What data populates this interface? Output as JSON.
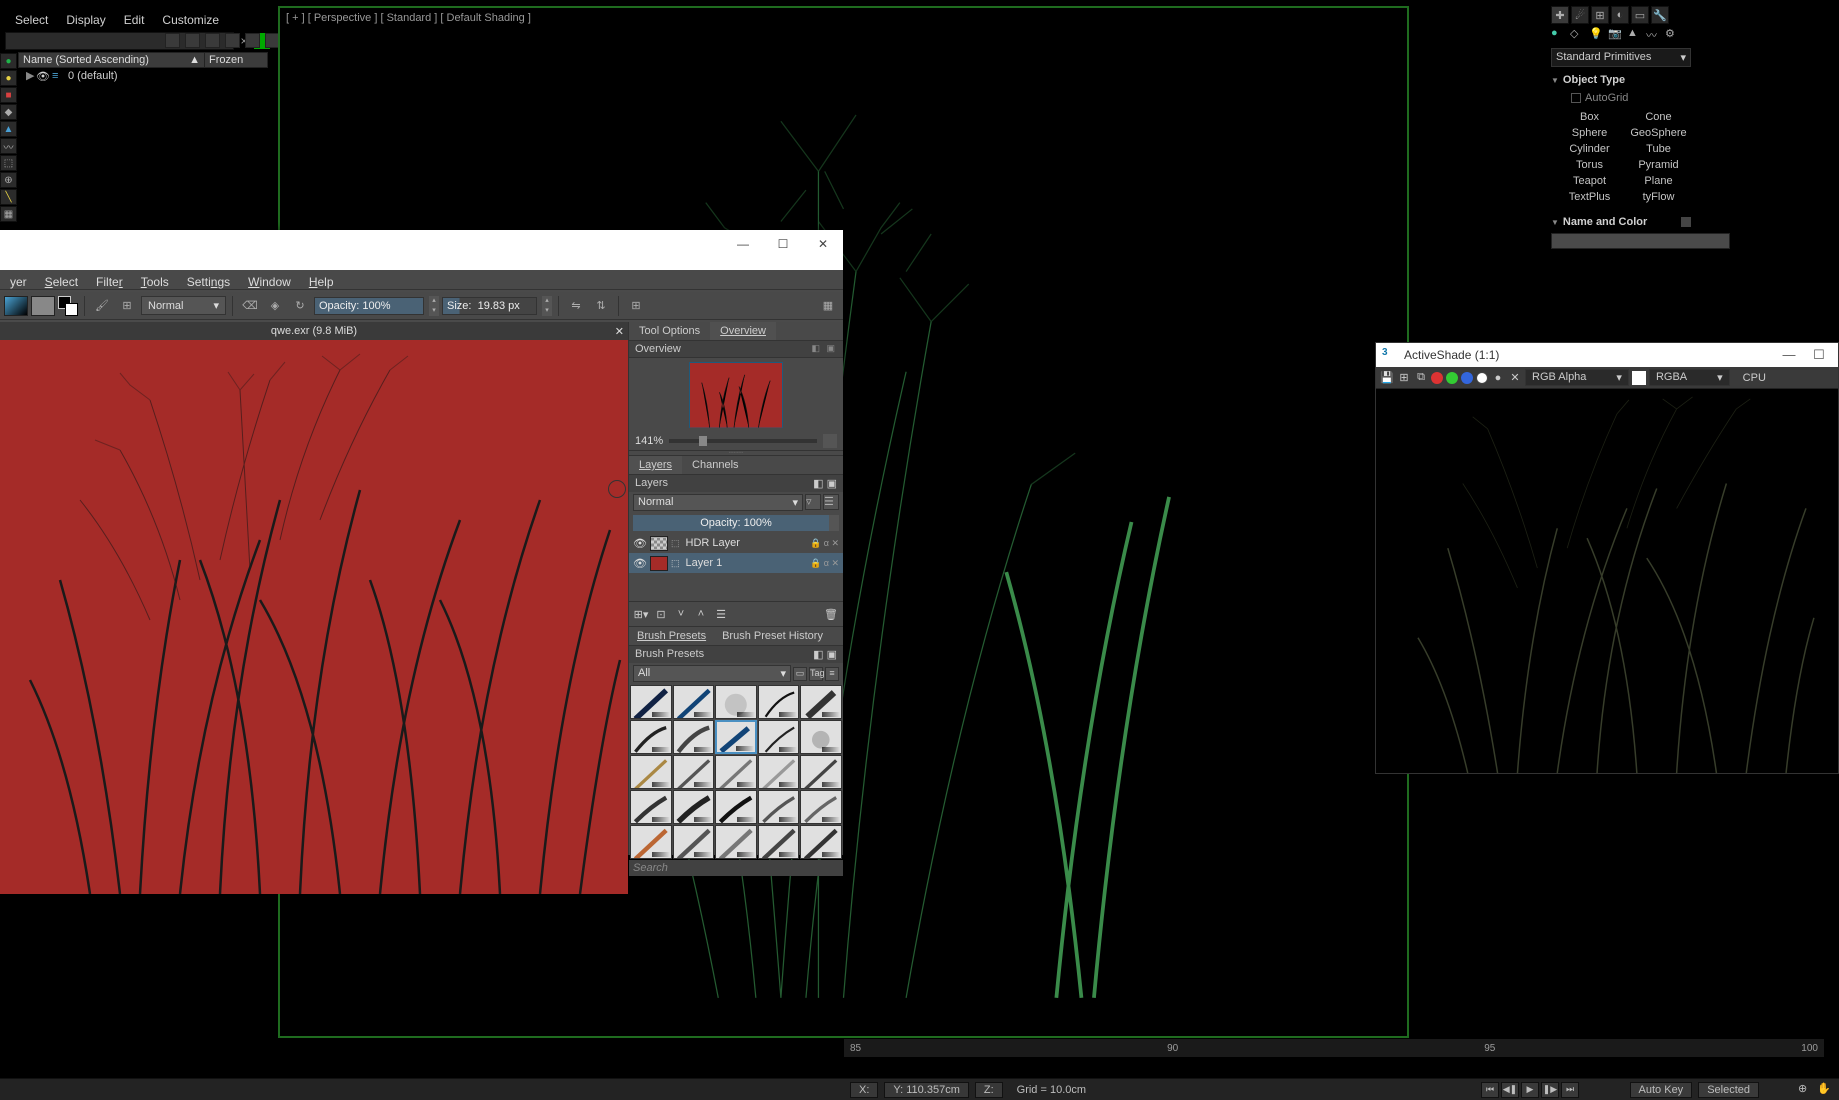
{
  "max": {
    "menu": [
      "Select",
      "Display",
      "Edit",
      "Customize"
    ],
    "search_placeholder": "",
    "outliner": {
      "col_name": "Name (Sorted Ascending)",
      "col_frozen": "Frozen",
      "row0": "0 (default)"
    },
    "viewport_label": "[ + ] [ Perspective ] [ Standard ] [ Default Shading ]",
    "cmd": {
      "dropdown": "Standard Primitives",
      "object_type": "Object Type",
      "autogrid": "AutoGrid",
      "primitives": [
        "Box",
        "Cone",
        "Sphere",
        "GeoSphere",
        "Cylinder",
        "Tube",
        "Torus",
        "Pyramid",
        "Teapot",
        "Plane",
        "TextPlus",
        "tyFlow"
      ],
      "name_color": "Name and Color"
    },
    "timeline_ticks": [
      "85",
      "90",
      "95",
      "100"
    ],
    "status": {
      "x": "X:",
      "y": "Y: 110.357cm",
      "z": "Z:",
      "grid": "Grid = 10.0cm",
      "autokey": "Auto Key",
      "selected": "Selected"
    }
  },
  "krita": {
    "menu": [
      "yer",
      "Select",
      "Filter",
      "Tools",
      "Settings",
      "Window",
      "Help"
    ],
    "blend_mode": "Normal",
    "opacity_label": "Opacity:  100%",
    "size_label": "Size:",
    "size_value": "19.83 px",
    "tab_title": "qwe.exr (9.8 MiB)",
    "tool_options_tab": "Tool Options",
    "overview_tab": "Overview",
    "overview_label": "Overview",
    "zoom_value": "141%",
    "layers_tab": "Layers",
    "channels_tab": "Channels",
    "layers_label": "Layers",
    "layers_blend": "Normal",
    "layers_opacity": "Opacity:  100%",
    "layer1_name": "HDR Layer",
    "layer2_name": "Layer 1",
    "brush_presets_tab": "Brush Presets",
    "brush_history_tab": "Brush Preset History",
    "brush_presets_label": "Brush Presets",
    "bp_filter_all": "All",
    "bp_tag": "Tag",
    "search_placeholder": "Search"
  },
  "activeshade": {
    "title": "ActiveShade (1:1)",
    "channel_dd": "RGB Alpha",
    "display_dd": "RGBA",
    "renderer": "CPU"
  }
}
